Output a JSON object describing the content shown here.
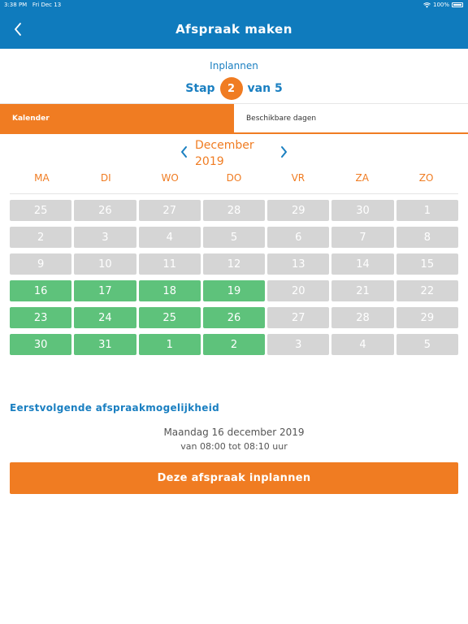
{
  "status_bar": {
    "time": "3:38 PM",
    "date": "Fri Dec 13",
    "battery": "100%"
  },
  "nav": {
    "title": "Afspraak maken",
    "back_icon": "chevron-left-icon"
  },
  "step": {
    "label": "Inplannen",
    "prefix": "Stap",
    "current": "2",
    "suffix": "van 5"
  },
  "tabs": [
    {
      "label": "Kalender",
      "active": true
    },
    {
      "label": "Beschikbare dagen",
      "active": false
    }
  ],
  "calendar": {
    "month_line1": "December",
    "month_line2": "2019",
    "weekdays": [
      "MA",
      "DI",
      "WO",
      "DO",
      "VR",
      "ZA",
      "ZO"
    ],
    "weeks": [
      [
        {
          "d": "25",
          "available": false
        },
        {
          "d": "26",
          "available": false
        },
        {
          "d": "27",
          "available": false
        },
        {
          "d": "28",
          "available": false
        },
        {
          "d": "29",
          "available": false
        },
        {
          "d": "30",
          "available": false
        },
        {
          "d": "1",
          "available": false
        }
      ],
      [
        {
          "d": "2",
          "available": false
        },
        {
          "d": "3",
          "available": false
        },
        {
          "d": "4",
          "available": false
        },
        {
          "d": "5",
          "available": false
        },
        {
          "d": "6",
          "available": false
        },
        {
          "d": "7",
          "available": false
        },
        {
          "d": "8",
          "available": false
        }
      ],
      [
        {
          "d": "9",
          "available": false
        },
        {
          "d": "10",
          "available": false
        },
        {
          "d": "11",
          "available": false
        },
        {
          "d": "12",
          "available": false
        },
        {
          "d": "13",
          "available": false
        },
        {
          "d": "14",
          "available": false
        },
        {
          "d": "15",
          "available": false
        }
      ],
      [
        {
          "d": "16",
          "available": true
        },
        {
          "d": "17",
          "available": true
        },
        {
          "d": "18",
          "available": true
        },
        {
          "d": "19",
          "available": true
        },
        {
          "d": "20",
          "available": false
        },
        {
          "d": "21",
          "available": false
        },
        {
          "d": "22",
          "available": false
        }
      ],
      [
        {
          "d": "23",
          "available": true
        },
        {
          "d": "24",
          "available": true
        },
        {
          "d": "25",
          "available": true
        },
        {
          "d": "26",
          "available": true
        },
        {
          "d": "27",
          "available": false
        },
        {
          "d": "28",
          "available": false
        },
        {
          "d": "29",
          "available": false
        }
      ],
      [
        {
          "d": "30",
          "available": true
        },
        {
          "d": "31",
          "available": true
        },
        {
          "d": "1",
          "available": true
        },
        {
          "d": "2",
          "available": true
        },
        {
          "d": "3",
          "available": false
        },
        {
          "d": "4",
          "available": false
        },
        {
          "d": "5",
          "available": false
        }
      ]
    ]
  },
  "next_appointment": {
    "heading": "Eerstvolgende afspraakmogelijkheid",
    "date": "Maandag 16 december 2019",
    "time": "van 08:00 tot 08:10 uur"
  },
  "cta": {
    "label": "Deze afspraak inplannen"
  },
  "colors": {
    "primary_blue": "#0f7bbd",
    "accent_orange": "#f07c22",
    "available_green": "#5ec27b",
    "unavailable_gray": "#d5d5d5"
  }
}
